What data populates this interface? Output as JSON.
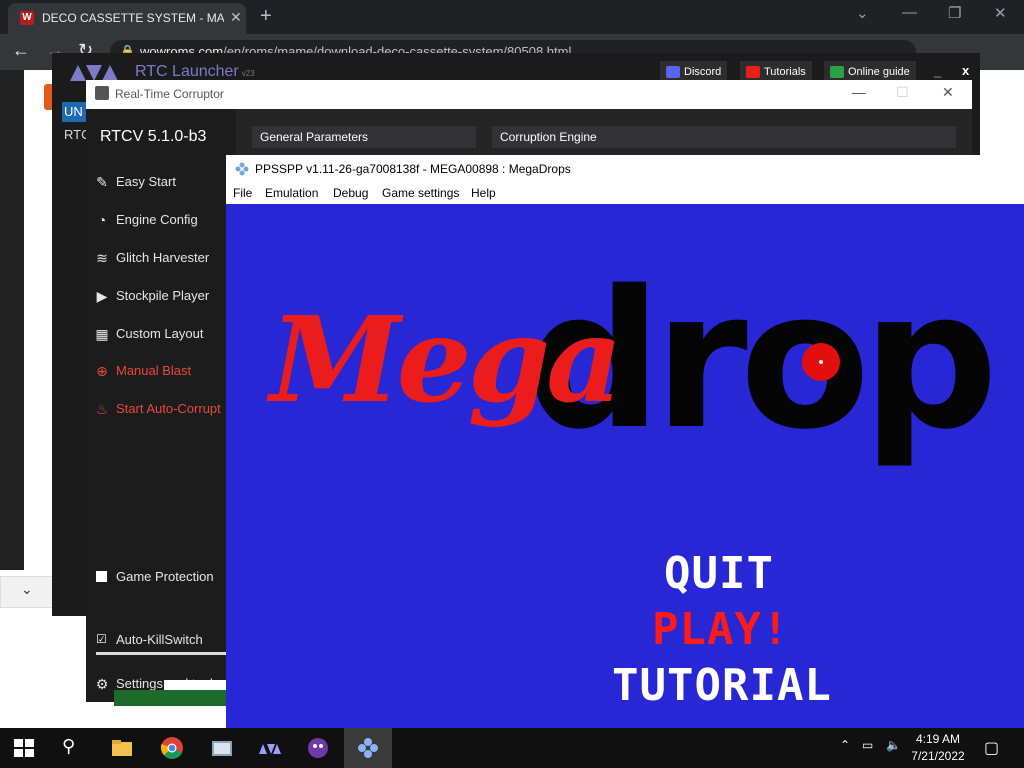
{
  "browser": {
    "tab_title": "DECO CASSETTE SYSTEM - MAM",
    "tab_favicon_letter": "W",
    "url_domain": "wowroms.com",
    "url_path": "/en/roms/mame/download-deco-cassette-system/80508.html"
  },
  "launcher": {
    "title": "RTC Launcher",
    "version_suffix": "v23",
    "buttons": [
      {
        "label": "Discord",
        "color": "#5865f2"
      },
      {
        "label": "Tutorials",
        "color": "#e62117"
      },
      {
        "label": "Online guide",
        "color": "#2ea043"
      }
    ],
    "close_glyph": "x",
    "partial_tag_un": "UN",
    "partial_tag_rtc": "RTC"
  },
  "rtc": {
    "window_title": "Real-Time Corruptor",
    "version": "RTCV 5.1.0-b3",
    "menu": [
      {
        "label": "Easy Start",
        "icon": "magic-wand-icon",
        "glyph": "✎"
      },
      {
        "label": "Engine Config",
        "icon": "gauge-icon",
        "glyph": "◔"
      },
      {
        "label": "Glitch Harvester",
        "icon": "layers-icon",
        "glyph": "≋"
      },
      {
        "label": "Stockpile Player",
        "icon": "play-icon",
        "glyph": "▶"
      },
      {
        "label": "Custom Layout",
        "icon": "grid-icon",
        "glyph": "▦"
      },
      {
        "label": "Manual Blast",
        "icon": "crosshair-icon",
        "glyph": "⊕"
      },
      {
        "label": "Start Auto-Corrupt",
        "icon": "flame-icon",
        "glyph": "♨"
      }
    ],
    "game_protection": "Game Protection",
    "auto_killswitch": "Auto-KillSwitch",
    "settings": "Settings and tools",
    "panels": {
      "general": "General Parameters",
      "engine": "Corruption Engine"
    },
    "accent_red": "#e8493a"
  },
  "ppsspp": {
    "window_title": "PPSSPP v1.11-26-ga7008138f - MEGA00898 : MegaDrops",
    "menu": [
      "File",
      "Emulation",
      "Debug",
      "Game settings",
      "Help"
    ],
    "game": {
      "logo_part1": "Mega",
      "logo_part2": "drop",
      "options": [
        {
          "label": "QUIT",
          "color": "#ffffff"
        },
        {
          "label": "PLAY!",
          "color": "#ff1a1a"
        },
        {
          "label": "TUTORIAL",
          "color": "#ffffff"
        }
      ],
      "background": "#2727d6"
    }
  },
  "taskbar": {
    "time": "4:19 AM",
    "date": "7/21/2022"
  }
}
